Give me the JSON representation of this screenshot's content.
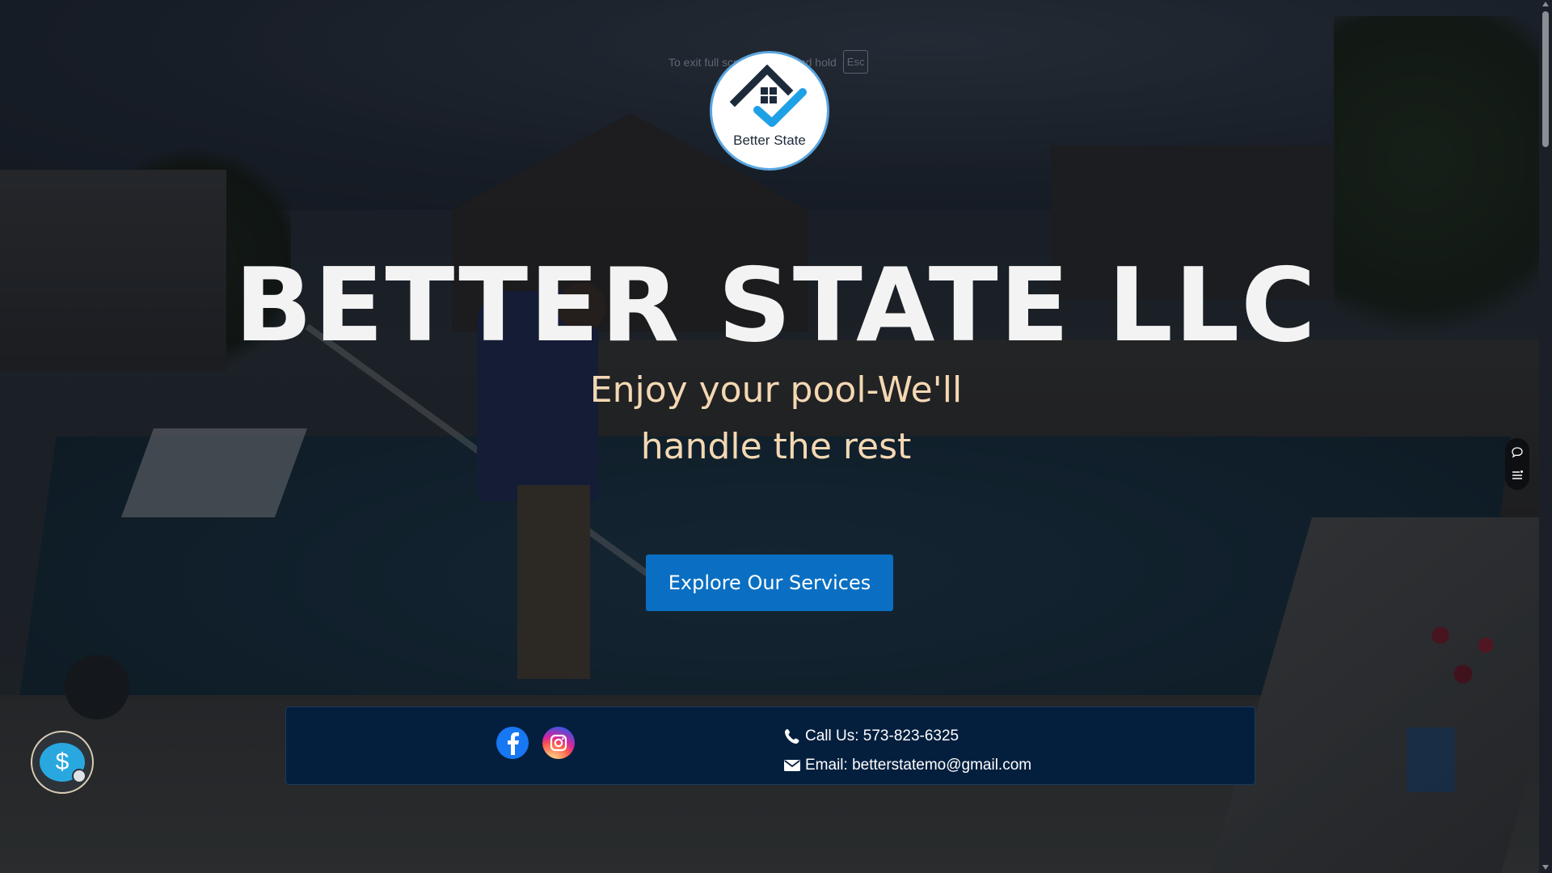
{
  "fullscreen_notice": {
    "text": "To exit full screen, press and hold",
    "key": "Esc"
  },
  "logo": {
    "text": "Better State",
    "icon": "house-check-icon",
    "colors": {
      "dark": "#1c2a3a",
      "accent": "#1ea0e6"
    }
  },
  "hero": {
    "title": "BETTER STATE LLC",
    "tagline_line1": "Enjoy your pool-We'll",
    "tagline_line2": "handle the rest",
    "cta_label": "Explore Our Services"
  },
  "info_bar": {
    "social": [
      {
        "name": "facebook",
        "icon": "facebook-icon"
      },
      {
        "name": "instagram",
        "icon": "instagram-icon"
      }
    ],
    "phone_label": "Call Us: 573-823-6325",
    "email_label": "Email: betterstatemo@gmail.com"
  },
  "widgets": {
    "price_chat_icon": "dollar-chat-icon",
    "side_icons": [
      "comment-icon",
      "list-icon"
    ]
  },
  "colors": {
    "cta_bg": "#0a6fc2",
    "tagline": "#f4d8b3",
    "info_bar_bg": "#041f3e"
  }
}
